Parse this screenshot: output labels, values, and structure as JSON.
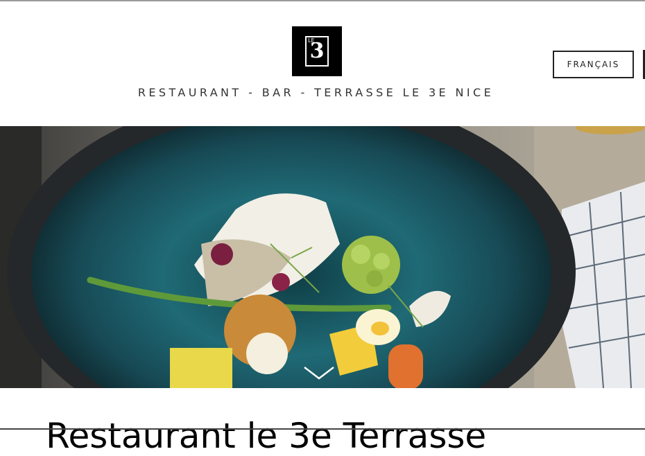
{
  "header": {
    "logo_text": "3",
    "logo_small_text": "LE",
    "tagline": "RESTAURANT - BAR - TERRASSE LE 3E NICE",
    "language_button": "FRANÇAIS"
  },
  "hero": {
    "image": "plated fish dish with vegetables on teal ceramic bowl",
    "scroll_icon": "chevron-down-icon"
  },
  "main": {
    "heading_partial": "Restaurant le 3e Terrasse"
  },
  "colors": {
    "background": "#ffffff",
    "text": "#333333",
    "logo_bg": "#000000",
    "bowl_teal": "#1e5a66"
  }
}
